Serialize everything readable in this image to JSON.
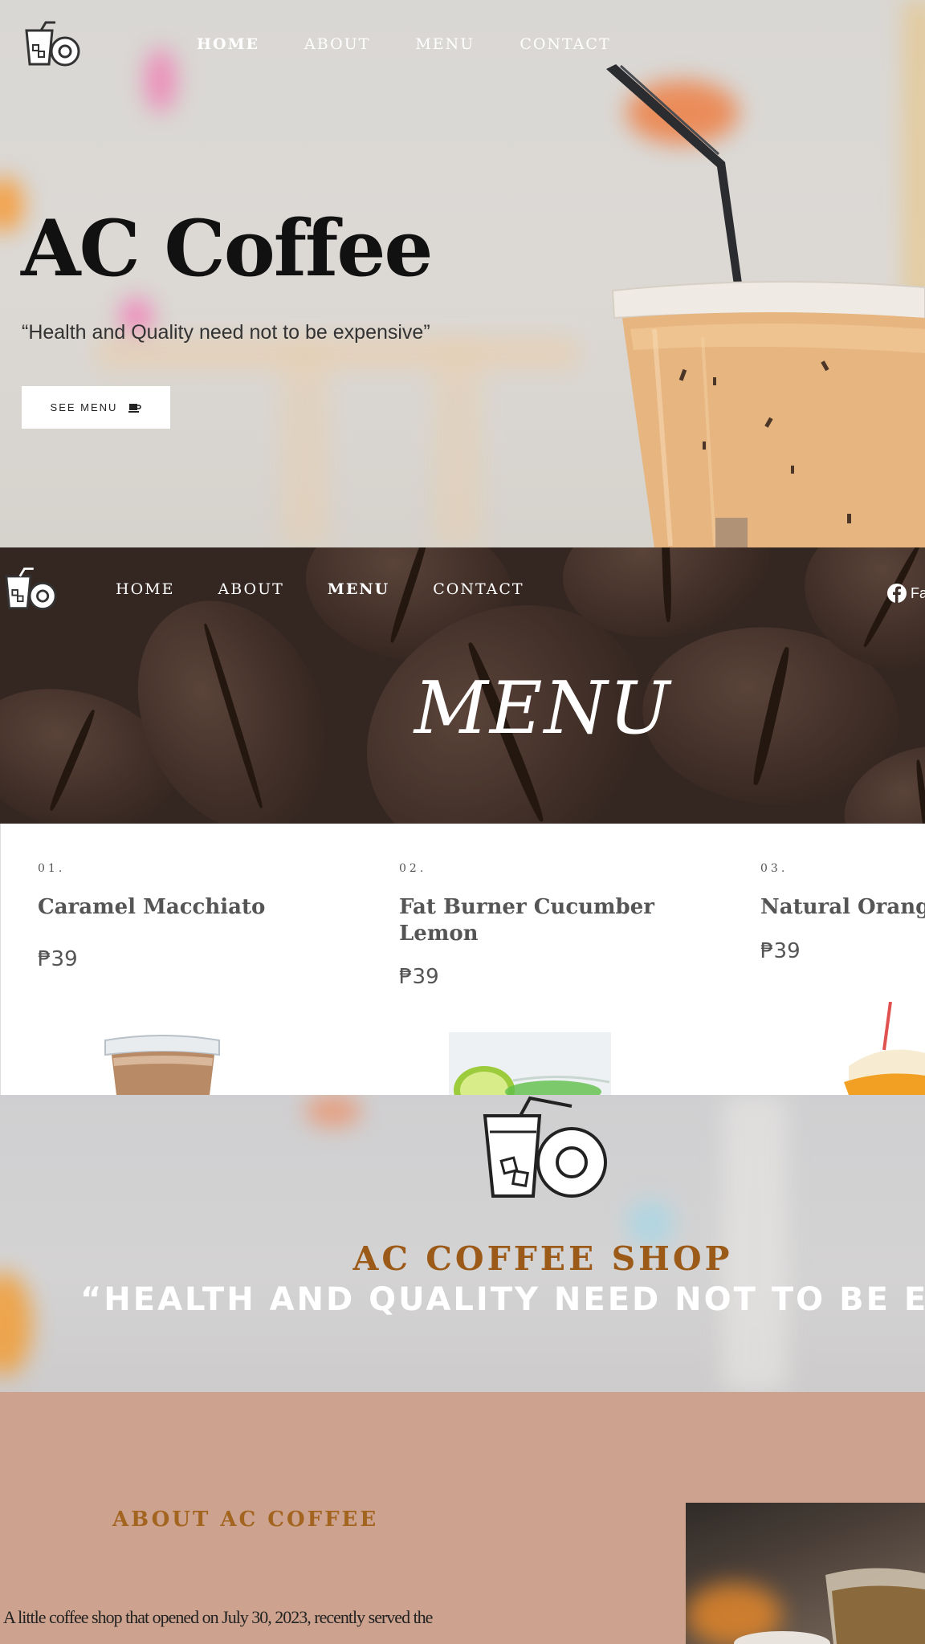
{
  "hero": {
    "nav": {
      "home": "HOME",
      "about": "ABOUT",
      "menu": "MENU",
      "contact": "CONTACT"
    },
    "title": "AC Coffee",
    "quote": "“Health and Quality need not to be expensive”",
    "see_menu_label": "SEE MENU"
  },
  "menu_banner": {
    "nav": {
      "home": "HOME",
      "about": "ABOUT",
      "menu": "MENU",
      "contact": "CONTACT"
    },
    "heading": "MENU",
    "social_label": "Fa"
  },
  "menu_items": [
    {
      "number": "01.",
      "name": "Caramel Macchiato",
      "price": "₱39"
    },
    {
      "number": "02.",
      "name": "Fat Burner Cucumber Lemon",
      "price": "₱39"
    },
    {
      "number": "03.",
      "name": "Natural Orange J",
      "price": "₱39"
    }
  ],
  "shop_band": {
    "title": "AC COFFEE SHOP",
    "quote": "“HEALTH AND QUALITY NEED NOT TO BE EXPENS"
  },
  "about": {
    "title": "ABOUT AC COFFEE",
    "text": "A little coffee shop that opened on July 30, 2023, recently served the"
  },
  "colors": {
    "accent_brown": "#9c5a18",
    "about_bg": "#cda38f",
    "banner_bg": "#3b2d27"
  }
}
